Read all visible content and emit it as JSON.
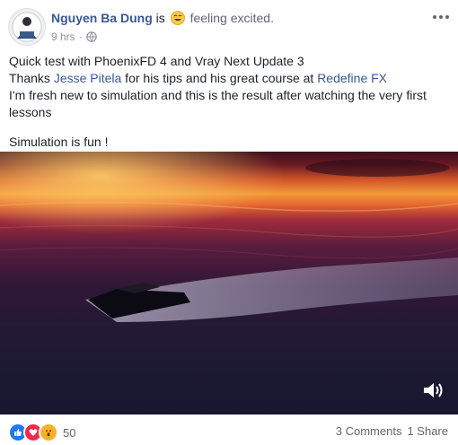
{
  "header": {
    "author": "Nguyen Ba Dung",
    "connector": "is",
    "feeling": "feeling excited.",
    "time": "9 hrs",
    "separator": "·"
  },
  "post": {
    "line1": "Quick test with PhoenixFD 4 and Vray Next Update 3",
    "thanks_prefix": "Thanks ",
    "mention_person": "Jesse Pitela",
    "thanks_middle": " for his tips and his great course at ",
    "mention_page": "Redefine FX",
    "line3": "I'm fresh new to simulation and this is the result after watching the very first lessons",
    "line4": "Simulation is fun !"
  },
  "footer": {
    "reaction_count": "50",
    "comments": "3 Comments",
    "shares": "1 Share"
  },
  "icons": {
    "feeling": "smiling-face-icon",
    "privacy": "globe-icon",
    "menu": "more-options-icon",
    "audio": "volume-icon",
    "reactions": [
      "like-icon",
      "love-icon",
      "wow-icon"
    ]
  },
  "colors": {
    "link": "#385898",
    "text": "#1d2129",
    "muted": "#606770",
    "like": "#2078f4",
    "love": "#f0284a",
    "wow": "#f7b125"
  }
}
